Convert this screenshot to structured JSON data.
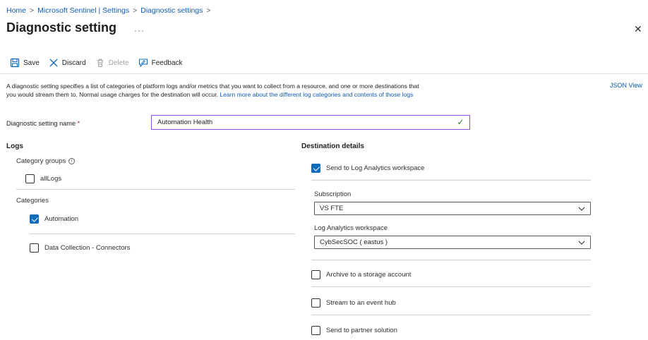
{
  "breadcrumb": [
    {
      "label": "Home"
    },
    {
      "label": "Microsoft Sentinel | Settings"
    },
    {
      "label": "Diagnostic settings"
    }
  ],
  "breadcrumb_separator": ">",
  "page": {
    "title": "Diagnostic setting",
    "more_label": "···",
    "close_label": "✕"
  },
  "toolbar": {
    "save_label": "Save",
    "discard_label": "Discard",
    "delete_label": "Delete",
    "feedback_label": "Feedback"
  },
  "description": {
    "text": "A diagnostic setting specifies a list of categories of platform logs and/or metrics that you want to collect from a resource, and one or more destinations that you would stream them to. Normal usage charges for the destination will occur. ",
    "link": "Learn more about the different log categories and contents of those logs"
  },
  "json_view_label": "JSON View",
  "setting_name": {
    "label": "Diagnostic setting name",
    "required_mark": "*",
    "value": "Automation Health"
  },
  "logs": {
    "title": "Logs",
    "category_groups_label": "Category groups",
    "category_groups": [
      {
        "label": "allLogs",
        "checked": false
      }
    ],
    "categories_label": "Categories",
    "categories": [
      {
        "label": "Automation",
        "checked": true
      },
      {
        "label": "Data Collection - Connectors",
        "checked": false
      }
    ]
  },
  "destination": {
    "title": "Destination details",
    "log_analytics": {
      "label": "Send to Log Analytics workspace",
      "checked": true
    },
    "subscription_label": "Subscription",
    "subscription_value": "VS FTE",
    "workspace_label": "Log Analytics workspace",
    "workspace_value": "CybSecSOC ( eastus )",
    "archive": {
      "label": "Archive to a storage account",
      "checked": false
    },
    "event_hub": {
      "label": "Stream to an event hub",
      "checked": false
    },
    "partner": {
      "label": "Send to partner solution",
      "checked": false
    }
  },
  "colors": {
    "link": "#0f5bb5",
    "checkbox_checked": "#0f6cbd",
    "input_focus_border": "#8a4ad1",
    "valid_check": "#107c10",
    "required": "#a4262c"
  },
  "icons": {
    "save": "save-icon",
    "discard": "close-icon",
    "delete": "trash-icon",
    "feedback": "feedback-icon",
    "info": "info-icon",
    "chevron": "chevron-down-icon",
    "valid": "checkmark-icon"
  }
}
